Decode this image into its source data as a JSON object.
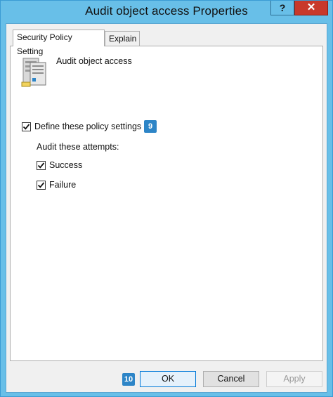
{
  "window": {
    "title": "Audit object access Properties",
    "help_label": "?",
    "close_label": "✕"
  },
  "tabs": [
    {
      "label": "Security Policy Setting",
      "active": true
    },
    {
      "label": "Explain",
      "active": false
    }
  ],
  "policy": {
    "name": "Audit object access",
    "icon": "server-policy-icon"
  },
  "settings": {
    "define_label": "Define these policy settings",
    "define_checked": true,
    "audit_label": "Audit these attempts:",
    "success_label": "Success",
    "success_checked": true,
    "failure_label": "Failure",
    "failure_checked": true
  },
  "badges": {
    "define_badge": "9",
    "ok_badge": "10",
    "color": "#2d85c7"
  },
  "buttons": {
    "ok_label": "OK",
    "cancel_label": "Cancel",
    "apply_label": "Apply",
    "apply_enabled": false
  },
  "colors": {
    "frame": "#68bfe8",
    "close": "#c8392b"
  }
}
